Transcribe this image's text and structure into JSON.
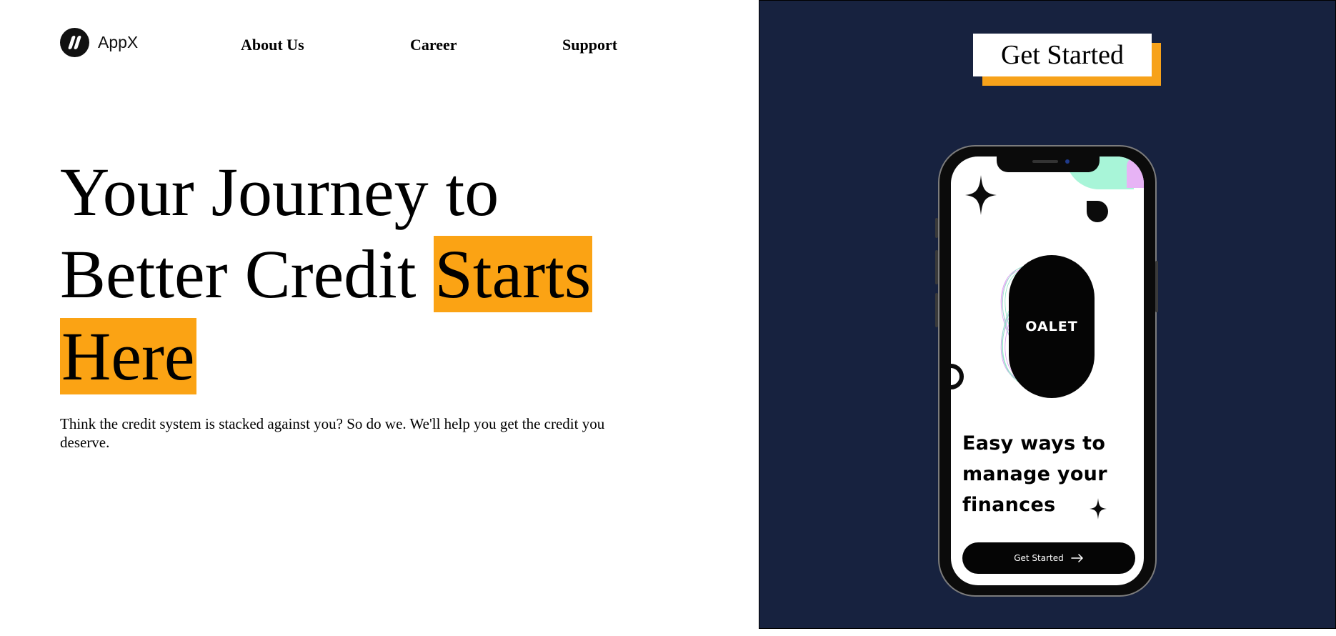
{
  "brand": {
    "name": "AppX",
    "icon": "appx-logo-icon"
  },
  "nav": {
    "items": [
      "About Us",
      "Career",
      "Support"
    ]
  },
  "hero": {
    "line1": "Your Journey to",
    "line2_plain": "Better Credit ",
    "line2_highlight": "Starts",
    "line3_highlight": "Here",
    "subtext": "Think the credit system is stacked against you? So do we. We'll help you get the credit you deserve."
  },
  "cta": {
    "label": "Get Started"
  },
  "phone": {
    "brand": "OALET",
    "headline": "Easy ways to manage your finances",
    "button_label": "Get Started",
    "button_icon": "arrow-right-icon"
  },
  "colors": {
    "accent": "#fba314",
    "panel": "#17223f",
    "mint": "#a8f5d8",
    "lilac": "#e7b3f5"
  }
}
